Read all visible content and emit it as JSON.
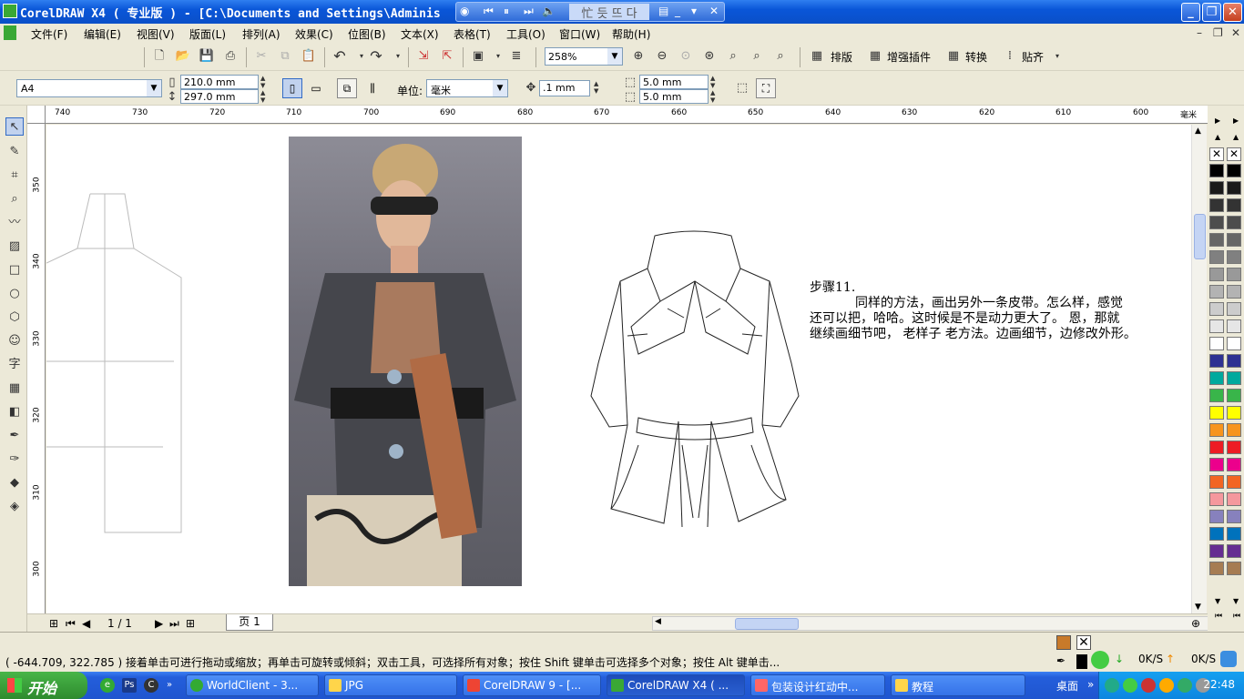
{
  "window": {
    "title": "CorelDRAW X4 ( 专业版 ) - [C:\\Documents and Settings\\Adminis"
  },
  "mediabar": {
    "text": "忙 듯 뜨 다"
  },
  "menu": {
    "items": [
      "文件(F)",
      "编辑(E)",
      "视图(V)",
      "版面(L)",
      "排列(A)",
      "效果(C)",
      "位图(B)",
      "文本(X)",
      "表格(T)",
      "工具(O)",
      "窗口(W)",
      "帮助(H)"
    ]
  },
  "toolbar": {
    "zoom": "258%",
    "layout_btn": "排版",
    "plugin_btn": "增强插件",
    "convert_btn": "转换",
    "paste_btn": "贴齐"
  },
  "propbar": {
    "paper": "A4",
    "width": "210.0 mm",
    "height": "297.0 mm",
    "unit_label": "单位:",
    "unit": "毫米",
    "nudge": ".1 mm",
    "dup_x": "5.0 mm",
    "dup_y": "5.0 mm"
  },
  "ruler": {
    "h_ticks": [
      "740",
      "730",
      "720",
      "710",
      "700",
      "690",
      "680",
      "670",
      "660",
      "650",
      "640",
      "630",
      "620",
      "610",
      "600"
    ],
    "h_unit": "毫米",
    "v_ticks": [
      "350",
      "340",
      "330",
      "320",
      "310",
      "300"
    ]
  },
  "canvas": {
    "step_title": "步骤11.",
    "step_line1": "同样的方法，画出另外一条皮带。怎么样，感觉",
    "step_line2": "还可以把，哈哈。这时候是不是动力更大了。 恩，那就",
    "step_line3": "继续画细节吧， 老样子 老方法。边画细节，边修改外形。"
  },
  "pagebar": {
    "page_count": "1 / 1",
    "page_tab": "页 1"
  },
  "status": {
    "text": "( -644.709, 322.785 )  接着单击可进行拖动或缩放；再单击可旋转或倾斜；双击工具，可选择所有对象；按住 Shift 键单击可选择多个对象；按住 Alt 键单击...",
    "down_speed": "0K/S",
    "up_speed": "0K/S"
  },
  "taskbar": {
    "start": "开始",
    "tasks": [
      "WorldClient - 3...",
      "JPG",
      "CorelDRAW 9 - [...",
      "CorelDRAW X4 ( ...",
      "包装设计红动中...",
      "教程"
    ],
    "desktop": "桌面",
    "clock": "22:48"
  },
  "palette_colors": [
    "#000000",
    "#1a1a1a",
    "#333333",
    "#4d4d4d",
    "#666666",
    "#808080",
    "#999999",
    "#b3b3b3",
    "#cccccc",
    "#e6e6e6",
    "#ffffff",
    "#2e3192",
    "#00a99d",
    "#39b54a",
    "#ffff00",
    "#f7941d",
    "#ed1c24",
    "#ec008c",
    "#f26522",
    "#f5989d",
    "#8781bd",
    "#0072bc",
    "#662d91",
    "#a67c52"
  ]
}
